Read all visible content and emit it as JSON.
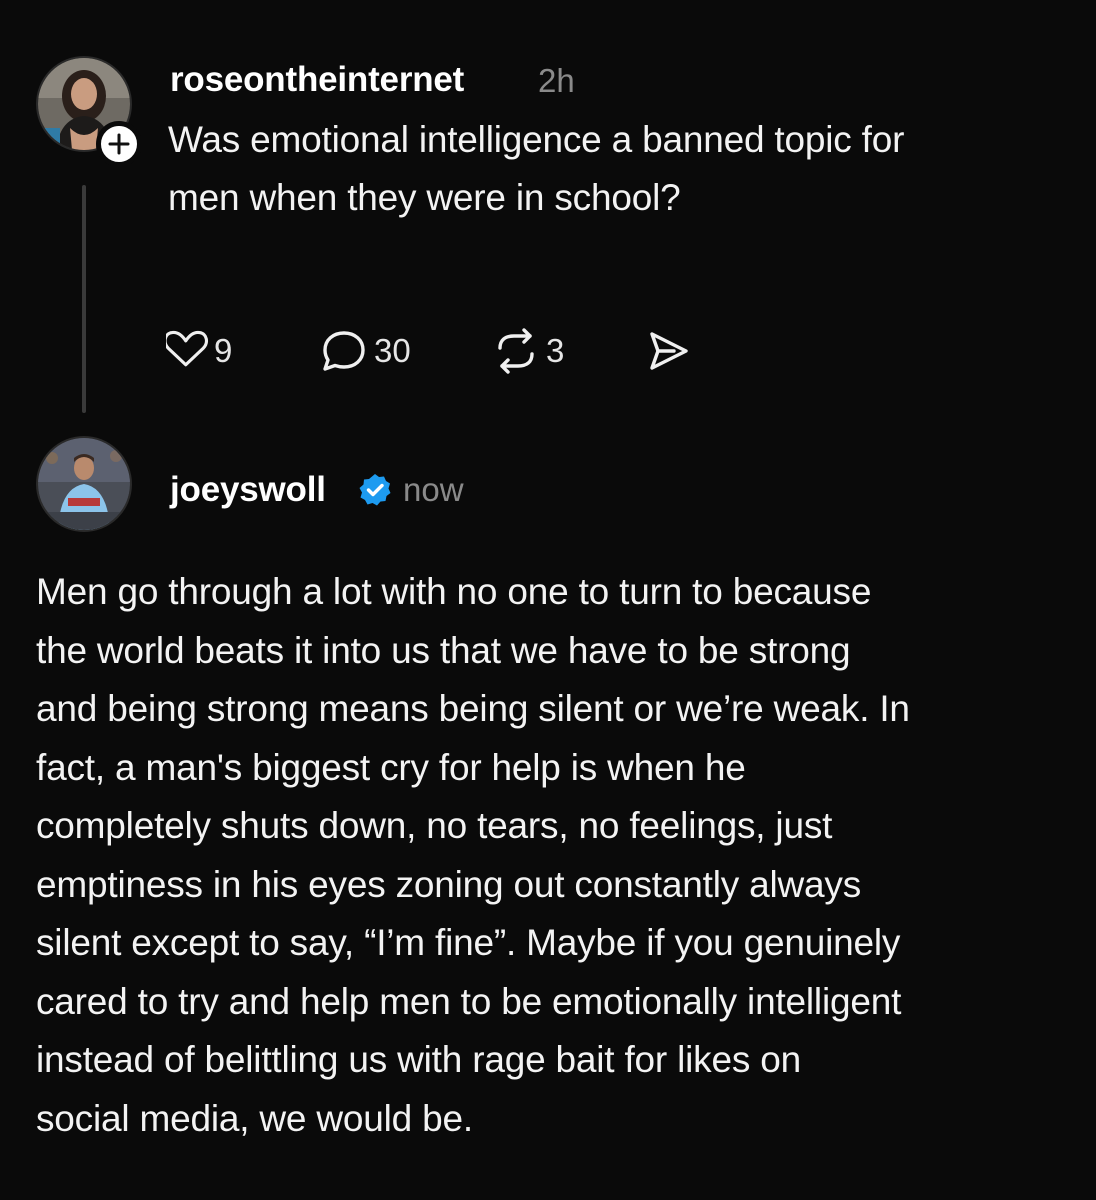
{
  "post": {
    "username": "roseontheinternet",
    "timestamp": "2h",
    "text_lines": [
      "Was emotional intelligence a banned topic for",
      "men when they were in school?"
    ],
    "actions": {
      "like_count": "9",
      "reply_count": "30",
      "repost_count": "3"
    }
  },
  "reply": {
    "username": "joeyswoll",
    "verified": true,
    "timestamp": "now",
    "text_lines": [
      "Men go through a lot with no one to turn to because",
      "the world beats it into us that we have to be strong",
      "and being strong means being silent or we’re weak. In",
      "fact, a man's biggest cry for help is when he",
      "completely shuts down, no tears, no feelings, just",
      "emptiness in his eyes zoning out constantly always",
      "silent except to say, “I’m fine”. Maybe if you genuinely",
      "cared to try and help men to be emotionally intelligent",
      "instead of belittling us with rage bait for likes on",
      "social media, we would be."
    ]
  },
  "colors": {
    "background": "#0a0a0a",
    "text": "#f3f3f3",
    "muted": "#8a8a8a",
    "verified_badge": "#1d9bf0"
  },
  "icons": [
    "follow-plus-icon",
    "heart-icon",
    "comment-icon",
    "repost-icon",
    "share-icon",
    "verified-badge-icon"
  ]
}
